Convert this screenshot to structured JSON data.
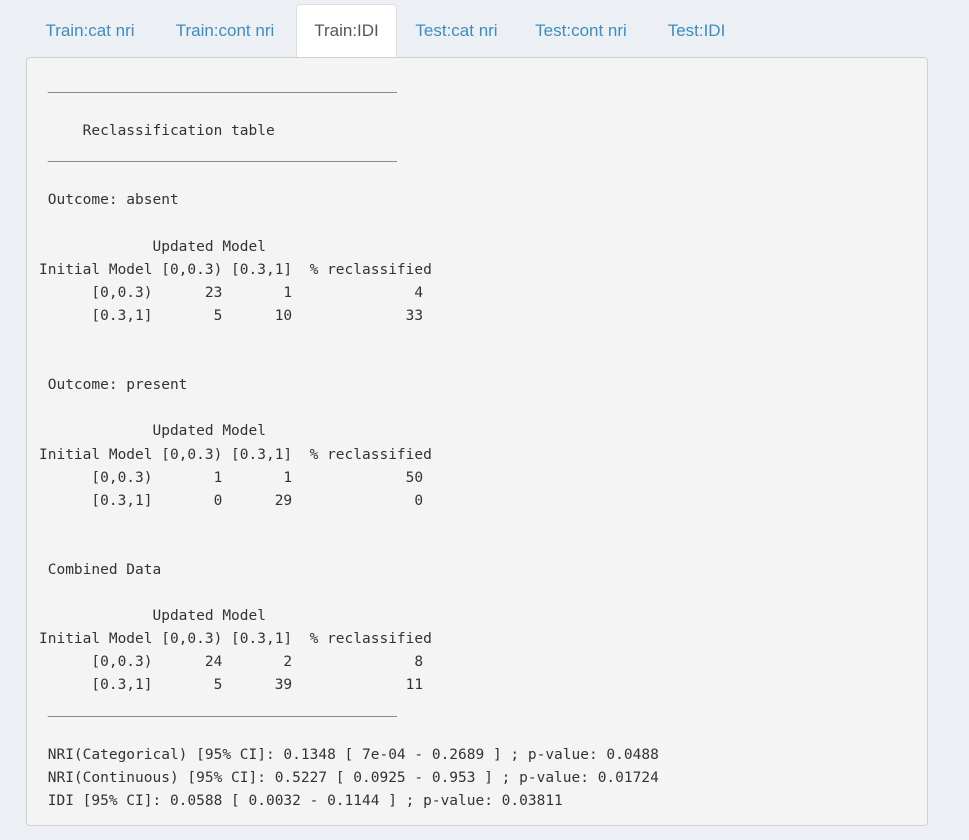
{
  "tabs": [
    {
      "label": "Train:cat nri",
      "active": false
    },
    {
      "label": "Train:cont nri",
      "active": false
    },
    {
      "label": "Train:IDI",
      "active": true
    },
    {
      "label": "Test:cat nri",
      "active": false
    },
    {
      "label": "Test:cont nri",
      "active": false
    },
    {
      "label": "Test:IDI",
      "active": false
    }
  ],
  "output": {
    "lines": [
      " ________________________________________",
      "",
      "     Reclassification table",
      " ________________________________________",
      "",
      " Outcome: absent",
      "",
      "             Updated Model",
      "Initial Model [0,0.3) [0.3,1]  % reclassified",
      "      [0,0.3)      23       1              4",
      "      [0.3,1]       5      10             33",
      "",
      "",
      " Outcome: present",
      "",
      "             Updated Model",
      "Initial Model [0,0.3) [0.3,1]  % reclassified",
      "      [0,0.3)       1       1             50",
      "      [0.3,1]       0      29              0",
      "",
      "",
      " Combined Data",
      "",
      "             Updated Model",
      "Initial Model [0,0.3) [0.3,1]  % reclassified",
      "      [0,0.3)      24       2              8",
      "      [0.3,1]       5      39             11",
      " ________________________________________",
      "",
      " NRI(Categorical) [95% CI]: 0.1348 [ 7e-04 - 0.2689 ] ; p-value: 0.0488",
      " NRI(Continuous) [95% CI]: 0.5227 [ 0.0925 - 0.953 ] ; p-value: 0.01724",
      " IDI [95% CI]: 0.0588 [ 0.0032 - 0.1144 ] ; p-value: 0.03811"
    ]
  }
}
